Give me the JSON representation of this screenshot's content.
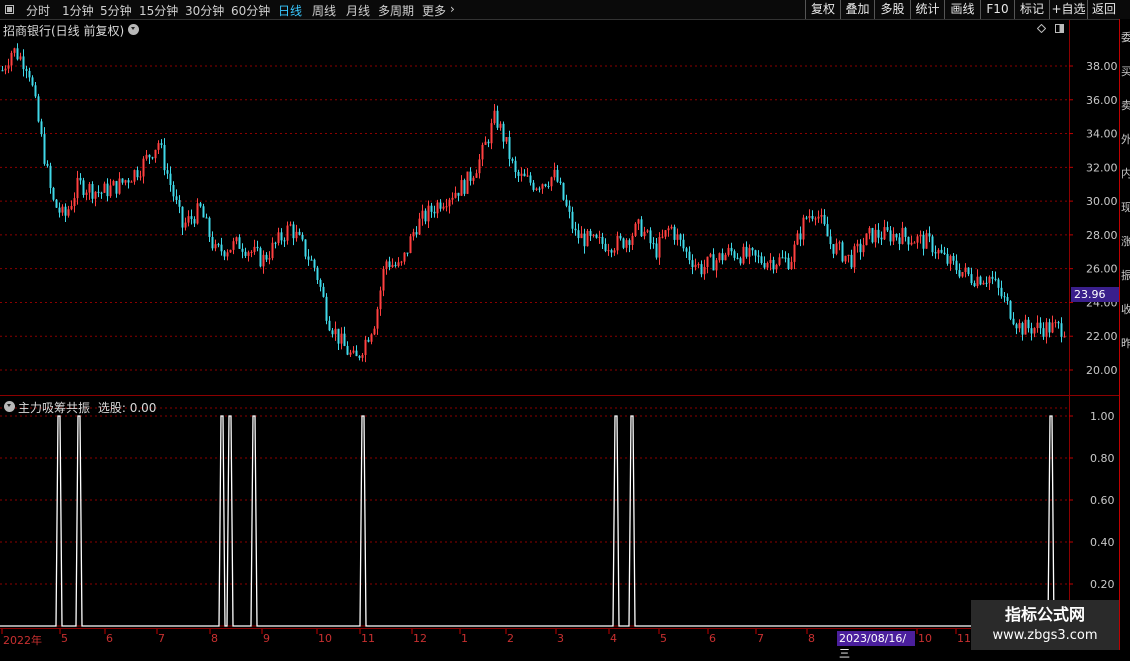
{
  "toolbar": {
    "icon": "window-icon",
    "periods": [
      "分时",
      "1分钟",
      "5分钟",
      "15分钟",
      "30分钟",
      "60分钟",
      "日线",
      "周线",
      "月线",
      "多周期",
      "更多"
    ],
    "active_index": 6,
    "buttons": [
      "复权",
      "叠加",
      "多股",
      "统计",
      "画线",
      "F10",
      "标记",
      "+自选",
      "返回"
    ]
  },
  "main_panel": {
    "title": "招商银行(日线 前复权)",
    "price_ticks": [
      "38.00",
      "36.00",
      "34.00",
      "32.00",
      "30.00",
      "28.00",
      "26.00",
      "24.00",
      "22.00",
      "20.00"
    ],
    "current_price": "23.96"
  },
  "indicator_panel": {
    "title": "主力吸筹共振",
    "value_label": "选股: 0.00",
    "ticks": [
      "1.00",
      "0.80",
      "0.60",
      "0.40",
      "0.20"
    ]
  },
  "x_axis": {
    "labels": [
      "2022年",
      "5",
      "6",
      "7",
      "8",
      "9",
      "10",
      "11",
      "12",
      "1",
      "2",
      "3",
      "4",
      "5",
      "6",
      "7",
      "8",
      "10",
      "11"
    ],
    "cursor_date": "2023/08/16/三"
  },
  "right_strip": [
    "委",
    "买",
    "卖",
    "外",
    "内",
    "现",
    "涨",
    "振",
    "收",
    "昨"
  ],
  "watermark": {
    "name": "指标公式网",
    "url": "www.zbgs3.com"
  },
  "colors": {
    "up": "#ff4040",
    "down": "#40d8e8",
    "grid": "#8b0000",
    "signal": "#ffffff"
  },
  "chart_data": {
    "type": "candlestick",
    "price_range": [
      19,
      40
    ],
    "trend": [
      [
        0,
        37.5
      ],
      [
        12,
        39
      ],
      [
        28,
        38
      ],
      [
        40,
        34
      ],
      [
        52,
        30
      ],
      [
        64,
        29
      ],
      [
        78,
        31
      ],
      [
        100,
        30.5
      ],
      [
        120,
        31
      ],
      [
        140,
        32
      ],
      [
        158,
        33.5
      ],
      [
        170,
        31
      ],
      [
        182,
        28.5
      ],
      [
        200,
        29.5
      ],
      [
        215,
        27
      ],
      [
        240,
        27.5
      ],
      [
        262,
        26.5
      ],
      [
        290,
        28.5
      ],
      [
        315,
        26
      ],
      [
        328,
        23
      ],
      [
        342,
        21.5
      ],
      [
        355,
        20.5
      ],
      [
        375,
        23
      ],
      [
        385,
        26.5
      ],
      [
        400,
        26
      ],
      [
        415,
        28.5
      ],
      [
        440,
        30
      ],
      [
        465,
        31
      ],
      [
        480,
        32.5
      ],
      [
        495,
        35
      ],
      [
        505,
        33.5
      ],
      [
        515,
        31.5
      ],
      [
        535,
        31
      ],
      [
        555,
        31.5
      ],
      [
        575,
        28
      ],
      [
        595,
        27.5
      ],
      [
        620,
        27.5
      ],
      [
        640,
        28.5
      ],
      [
        655,
        27
      ],
      [
        670,
        28.5
      ],
      [
        685,
        27
      ],
      [
        700,
        26
      ],
      [
        730,
        27
      ],
      [
        760,
        26.5
      ],
      [
        790,
        26.5
      ],
      [
        805,
        29
      ],
      [
        815,
        29.5
      ],
      [
        830,
        27.5
      ],
      [
        850,
        26.5
      ],
      [
        870,
        28
      ],
      [
        900,
        28
      ],
      [
        930,
        27.5
      ],
      [
        945,
        26.5
      ],
      [
        970,
        25.5
      ],
      [
        990,
        25.5
      ],
      [
        1005,
        24
      ],
      [
        1020,
        22.5
      ],
      [
        1040,
        22.5
      ],
      [
        1068,
        22.5
      ]
    ],
    "signals": [
      59,
      79,
      222,
      230,
      254,
      363,
      616,
      632,
      1051
    ],
    "indicator_range": [
      0,
      1.1
    ]
  }
}
